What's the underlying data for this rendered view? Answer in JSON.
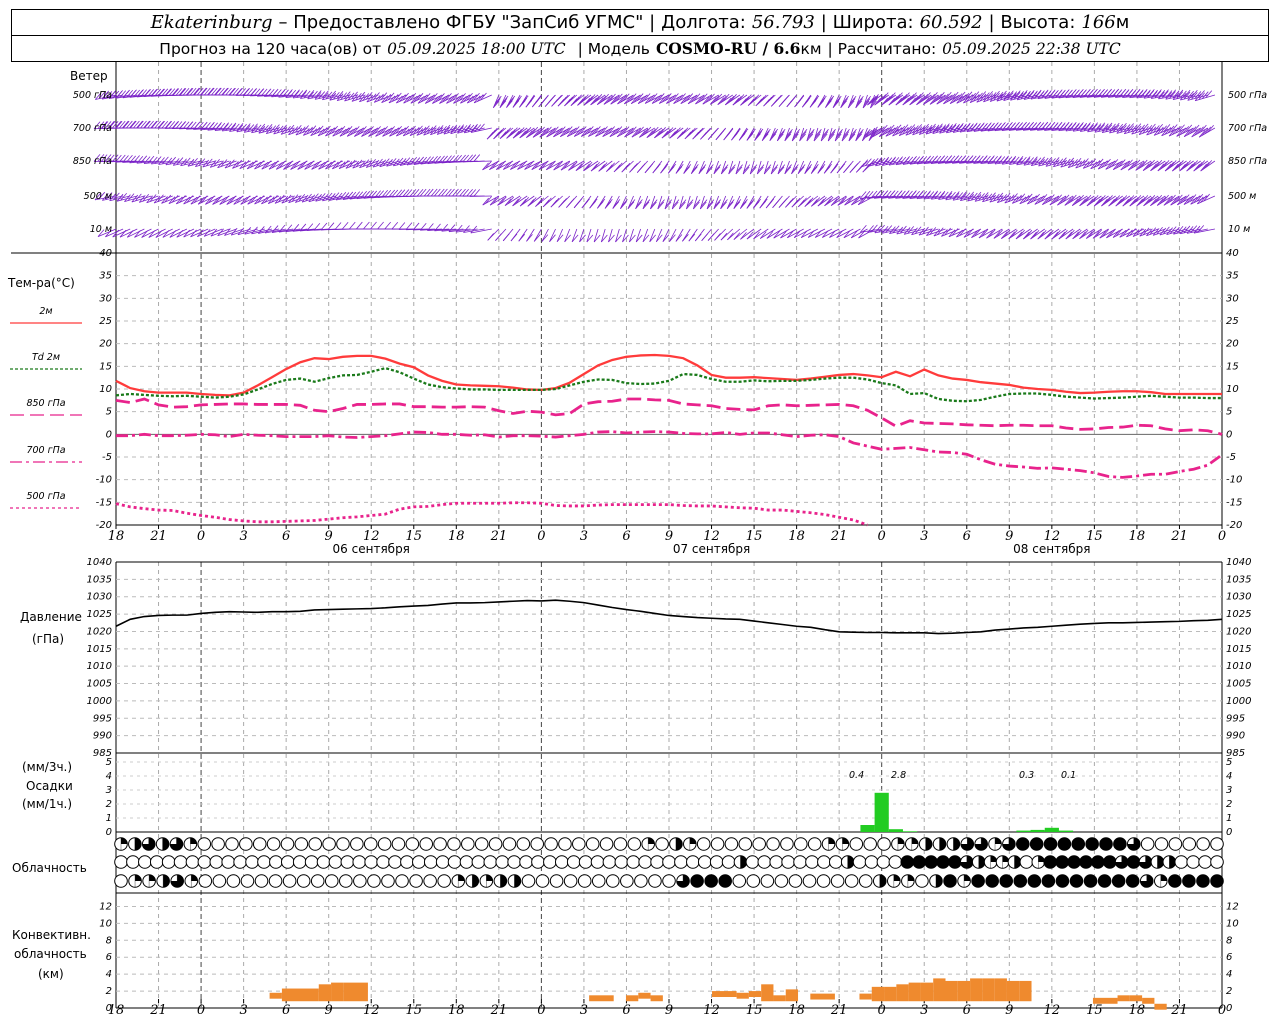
{
  "header": {
    "city": "Ekaterinburg",
    "provider": "– Предоставлено ФГБУ \"ЗапСиб УГМС\" |",
    "lon_label": "Долгота:",
    "lon": "56.793",
    "lat_label": "| Широта:",
    "lat": "60.592",
    "alt_label": "| Высота:",
    "alt": "166",
    "alt_unit": "м",
    "forecast_label": "Прогноз на 120 часа(ов) от",
    "init_time": "05.09.2025 18:00 UTC",
    "model_label": "| Модель",
    "model": "COSMO-RU / 6.6",
    "model_unit": "км",
    "calc_label": "| Рассчитано:",
    "calc_time": "05.09.2025 22:38 UTC"
  },
  "panels": {
    "wind": {
      "title": "Ветер",
      "levels": [
        "500 гПа",
        "700 гПа",
        "850 гПа",
        "500 м",
        "10 м"
      ]
    },
    "temp": {
      "title": "Тем-ра(°C)",
      "legend": [
        {
          "label": "2м",
          "color": "#ff3b3b",
          "dash": ""
        },
        {
          "label": "Td 2м",
          "color": "#1a7a1a",
          "dash": "3,2"
        },
        {
          "label": "850 гПа",
          "color": "#e8238c",
          "dash": "14,6"
        },
        {
          "label": "700 гПа",
          "color": "#e8238c",
          "dash": "12,4,3,4"
        },
        {
          "label": "500 гПа",
          "color": "#e8238c",
          "dash": "3,3"
        }
      ]
    },
    "pressure": {
      "title": "Давление",
      "unit": "(гПа)"
    },
    "precip": {
      "unit1": "(мм/3ч.)",
      "title": "Осадки",
      "unit2": "(мм/1ч.)",
      "annotations": [
        "0.4",
        "2.8",
        "0.3",
        "0.1"
      ]
    },
    "cloud": {
      "title": "Облачность"
    },
    "conv": {
      "title1": "Конвективн.",
      "title2": "облачность",
      "unit": "(км)"
    }
  },
  "time_axis": {
    "hour_labels": [
      "18",
      "21",
      "0",
      "3",
      "6",
      "9",
      "12",
      "15",
      "18",
      "21",
      "0",
      "3",
      "6",
      "9",
      "12",
      "15",
      "18",
      "21",
      "0",
      "3",
      "6",
      "9",
      "12",
      "15",
      "18",
      "21",
      "0"
    ],
    "days": [
      "06 сентября",
      "07 сентября",
      "08 сентября"
    ]
  },
  "chart_data": {
    "type": "line",
    "x_hours": [
      0,
      1,
      2,
      3,
      4,
      5,
      6,
      7,
      8,
      9,
      10,
      11,
      12,
      13,
      14,
      15,
      16,
      17,
      18,
      19,
      20,
      21,
      22,
      23,
      24,
      25,
      26,
      27,
      28,
      29,
      30,
      31,
      32,
      33,
      34,
      35,
      36,
      37,
      38,
      39,
      40,
      41,
      42,
      43,
      44,
      45,
      46,
      47,
      48,
      49,
      50,
      51,
      52,
      53,
      54,
      55,
      56,
      57,
      58,
      59,
      60,
      61,
      62,
      63,
      64,
      65,
      66,
      67,
      68,
      69,
      70,
      71,
      72,
      73,
      74,
      75,
      76,
      77,
      78
    ],
    "temperature": {
      "ylim": [
        -20,
        40
      ],
      "yticks": [
        -20,
        -15,
        -10,
        -5,
        0,
        5,
        10,
        15,
        20,
        25,
        30,
        35,
        40
      ],
      "series": [
        {
          "name": "2м",
          "values": [
            11.8,
            10.2,
            9.5,
            9.2,
            9.2,
            9.2,
            8.9,
            8.7,
            8.6,
            9.2,
            10.8,
            12.6,
            14.4,
            15.9,
            16.8,
            16.6,
            17.1,
            17.3,
            17.3,
            16.7,
            15.6,
            14.8,
            13.0,
            11.8,
            11.0,
            10.8,
            10.7,
            10.6,
            10.3,
            9.9,
            9.8,
            10.2,
            11.4,
            13.3,
            15.2,
            16.4,
            17.1,
            17.4,
            17.5,
            17.3,
            16.8,
            15.2,
            13.1,
            12.5,
            12.5,
            12.6,
            12.4,
            12.2,
            12.0,
            12.3,
            12.7,
            13.1,
            13.3,
            13.0,
            12.6,
            13.8,
            12.8,
            14.3,
            13.0,
            12.3,
            12.0,
            11.5,
            11.2,
            10.9,
            10.3,
            10.0,
            9.8,
            9.4,
            9.1,
            9.2,
            9.4,
            9.5,
            9.5,
            9.3,
            8.9,
            8.9,
            8.9,
            8.9,
            8.9
          ]
        },
        {
          "name": "Td 2м",
          "values": [
            8.6,
            8.9,
            8.7,
            8.5,
            8.4,
            8.5,
            8.3,
            8.1,
            8.3,
            8.8,
            9.9,
            11.1,
            12.0,
            12.3,
            11.6,
            12.4,
            13.0,
            13.1,
            13.8,
            14.6,
            13.7,
            12.3,
            11.0,
            10.4,
            10.1,
            9.9,
            9.9,
            9.8,
            9.8,
            9.8,
            9.8,
            10.0,
            10.8,
            11.6,
            12.1,
            12.0,
            11.3,
            11.1,
            11.2,
            11.8,
            13.3,
            13.1,
            12.2,
            11.6,
            11.6,
            11.9,
            11.7,
            11.8,
            11.8,
            12.0,
            12.3,
            12.5,
            12.5,
            12.1,
            11.3,
            10.8,
            8.9,
            9.1,
            7.8,
            7.4,
            7.3,
            7.6,
            8.3,
            8.9,
            9.0,
            9.0,
            8.7,
            8.3,
            8.1,
            7.9,
            8.0,
            8.1,
            8.3,
            8.5,
            8.3,
            8.1,
            8.1,
            8.0,
            8.0
          ]
        },
        {
          "name": "850 гПа",
          "values": [
            7.5,
            7.0,
            7.8,
            6.5,
            6.0,
            6.1,
            6.5,
            6.6,
            6.7,
            6.7,
            6.6,
            6.6,
            6.6,
            6.4,
            5.3,
            5.0,
            5.7,
            6.6,
            6.6,
            6.7,
            6.7,
            6.1,
            6.1,
            6.0,
            6.0,
            6.1,
            6.0,
            5.2,
            4.6,
            5.1,
            4.9,
            4.3,
            4.6,
            6.7,
            7.2,
            7.3,
            7.8,
            7.8,
            7.6,
            7.5,
            6.7,
            6.5,
            6.3,
            5.7,
            5.5,
            5.4,
            6.3,
            6.5,
            6.3,
            6.4,
            6.5,
            6.6,
            6.3,
            5.3,
            3.6,
            1.8,
            3.0,
            2.5,
            2.4,
            2.3,
            2.1,
            2.0,
            1.9,
            2.0,
            2.0,
            1.9,
            1.9,
            1.4,
            1.1,
            1.2,
            1.5,
            1.6,
            2.0,
            1.9,
            1.2,
            0.8,
            1.0,
            0.8,
            0.0
          ]
        },
        {
          "name": "700 гПа",
          "values": [
            -0.3,
            -0.3,
            0.0,
            -0.3,
            -0.3,
            -0.2,
            0.0,
            -0.1,
            -0.5,
            0.0,
            -0.2,
            -0.3,
            -0.5,
            -0.5,
            -0.5,
            -0.3,
            -0.6,
            -0.7,
            -0.5,
            -0.3,
            0.1,
            0.5,
            0.4,
            0.0,
            0.0,
            -0.2,
            -0.1,
            -0.6,
            -0.3,
            -0.3,
            -0.4,
            -0.6,
            -0.3,
            0.0,
            0.5,
            0.6,
            0.3,
            0.5,
            0.6,
            0.5,
            0.2,
            0.1,
            0.1,
            0.4,
            0.0,
            0.3,
            0.3,
            -0.1,
            -0.5,
            -0.2,
            -0.1,
            -0.5,
            -1.9,
            -2.6,
            -3.3,
            -3.1,
            -2.9,
            -3.4,
            -3.9,
            -4.0,
            -4.4,
            -5.6,
            -6.6,
            -7.0,
            -7.2,
            -7.5,
            -7.4,
            -7.7,
            -8.0,
            -8.5,
            -9.3,
            -9.5,
            -9.2,
            -8.8,
            -8.8,
            -8.2,
            -7.7,
            -6.8,
            -4.5
          ]
        },
        {
          "name": "500 гПа",
          "values": [
            -15.3,
            -16.0,
            -16.4,
            -16.7,
            -16.8,
            -17.4,
            -17.9,
            -18.3,
            -18.8,
            -19.1,
            -19.3,
            -19.3,
            -19.2,
            -19.1,
            -19.0,
            -18.7,
            -18.4,
            -18.2,
            -17.9,
            -17.6,
            -16.5,
            -16.0,
            -15.9,
            -15.5,
            -15.2,
            -15.2,
            -15.2,
            -15.2,
            -15.1,
            -15.1,
            -15.2,
            -15.7,
            -15.8,
            -15.8,
            -15.6,
            -15.5,
            -15.5,
            -15.5,
            -15.5,
            -15.5,
            -15.7,
            -15.8,
            -15.8,
            -16.0,
            -16.2,
            -16.3,
            -16.7,
            -16.7,
            -17.0,
            -17.3,
            -17.7,
            -18.3,
            -18.9,
            -20.0
          ]
        }
      ]
    },
    "pressure": {
      "ylim": [
        985,
        1040
      ],
      "yticks": [
        985,
        990,
        995,
        1000,
        1005,
        1010,
        1015,
        1020,
        1025,
        1030,
        1035,
        1040
      ],
      "values": [
        1021.5,
        1023.5,
        1024.3,
        1024.6,
        1024.7,
        1024.7,
        1025.2,
        1025.5,
        1025.7,
        1025.6,
        1025.5,
        1025.7,
        1025.7,
        1025.8,
        1026.2,
        1026.3,
        1026.4,
        1026.5,
        1026.6,
        1026.8,
        1027.1,
        1027.3,
        1027.5,
        1027.9,
        1028.2,
        1028.2,
        1028.3,
        1028.5,
        1028.7,
        1028.9,
        1028.8,
        1029.0,
        1028.7,
        1028.3,
        1027.6,
        1026.9,
        1026.3,
        1025.8,
        1025.2,
        1024.6,
        1024.3,
        1024.0,
        1023.8,
        1023.6,
        1023.5,
        1023.0,
        1022.5,
        1022.0,
        1021.5,
        1021.2,
        1020.5,
        1019.9,
        1019.8,
        1019.7,
        1019.7,
        1019.6,
        1019.6,
        1019.6,
        1019.4,
        1019.5,
        1019.7,
        1019.9,
        1020.4,
        1020.7,
        1021.0,
        1021.2,
        1021.5,
        1021.8,
        1022.1,
        1022.3,
        1022.5,
        1022.5,
        1022.6,
        1022.7,
        1022.8,
        1022.9,
        1023.1,
        1023.2,
        1023.5
      ]
    },
    "precipitation": {
      "ylim": [
        0,
        5
      ],
      "yticks": [
        0,
        1,
        2,
        3,
        4,
        5
      ],
      "bars": [
        {
          "hour": 53,
          "value": 0.5
        },
        {
          "hour": 54,
          "value": 2.8
        },
        {
          "hour": 55,
          "value": 0.2
        },
        {
          "hour": 56,
          "value": 0.05
        },
        {
          "hour": 64,
          "value": 0.1
        },
        {
          "hour": 65,
          "value": 0.15
        },
        {
          "hour": 66,
          "value": 0.3
        },
        {
          "hour": 67,
          "value": 0.1
        }
      ]
    },
    "cloud_cover": {
      "rows": [
        [
          2,
          4,
          6,
          4,
          6,
          2,
          0,
          0,
          0,
          0,
          0,
          0,
          0,
          0,
          0,
          0,
          0,
          0,
          0,
          0,
          0,
          0,
          0,
          0,
          0,
          0,
          0,
          0,
          0,
          0,
          0,
          0,
          0,
          0,
          0,
          0,
          0,
          0,
          2,
          0,
          4,
          2,
          0,
          0,
          0,
          0,
          0,
          0,
          0,
          0,
          0,
          2,
          2,
          0,
          0,
          0,
          2,
          2,
          4,
          4,
          4,
          6,
          6,
          2,
          6,
          8,
          8,
          8,
          8,
          8,
          8,
          8,
          8,
          6,
          0,
          0,
          0,
          0,
          0,
          0
        ],
        [
          0,
          0,
          0,
          0,
          0,
          0,
          0,
          0,
          0,
          0,
          0,
          0,
          0,
          0,
          0,
          0,
          0,
          0,
          0,
          0,
          0,
          0,
          0,
          0,
          0,
          0,
          0,
          0,
          0,
          0,
          0,
          0,
          0,
          0,
          0,
          0,
          0,
          0,
          0,
          0,
          0,
          0,
          0,
          0,
          0,
          0,
          0,
          0,
          0,
          0,
          0,
          0,
          4,
          0,
          0,
          0,
          0,
          0,
          0,
          0,
          0,
          4,
          0,
          0,
          0,
          0,
          8,
          8,
          8,
          8,
          8,
          6,
          4,
          2,
          2,
          4,
          0,
          2,
          8,
          8,
          8,
          8,
          8,
          8,
          6,
          8,
          6,
          4,
          4,
          0,
          0,
          0,
          0
        ],
        [
          0,
          2,
          2,
          4,
          6,
          2,
          0,
          0,
          0,
          0,
          0,
          0,
          0,
          0,
          0,
          0,
          0,
          0,
          0,
          0,
          0,
          0,
          0,
          0,
          2,
          4,
          2,
          4,
          4,
          0,
          0,
          0,
          0,
          0,
          0,
          0,
          0,
          0,
          0,
          0,
          6,
          8,
          8,
          8,
          0,
          0,
          0,
          0,
          0,
          0,
          0,
          0,
          0,
          0,
          4,
          2,
          2,
          0,
          4,
          8,
          2,
          8,
          8,
          8,
          8,
          8,
          8,
          8,
          8,
          8,
          8,
          8,
          8,
          6,
          2,
          8,
          8,
          8,
          8
        ]
      ]
    },
    "convective_cloud": {
      "ylim": [
        0,
        13
      ],
      "yticks": [
        0,
        2,
        4,
        6,
        8,
        10,
        12
      ],
      "segments": [
        {
          "from": 12.5,
          "to": 13.5,
          "top": 1.8
        },
        {
          "from": 13.5,
          "to": 16.5,
          "top": 2.3
        },
        {
          "from": 16.5,
          "to": 17.5,
          "top": 2.8
        },
        {
          "from": 17.5,
          "to": 18.5,
          "top": 3.0
        },
        {
          "from": 18.5,
          "to": 20.5,
          "top": 3.0
        },
        {
          "from": 38.5,
          "to": 40.5,
          "top": 1.5
        },
        {
          "from": 41.5,
          "to": 42.5,
          "top": 1.5
        },
        {
          "from": 42.5,
          "to": 43.5,
          "top": 1.8
        },
        {
          "from": 43.5,
          "to": 44.5,
          "top": 1.5
        },
        {
          "from": 48.5,
          "to": 50.5,
          "top": 2.0
        },
        {
          "from": 50.5,
          "to": 51.5,
          "top": 1.8
        },
        {
          "from": 51.5,
          "to": 52.5,
          "top": 2.0
        },
        {
          "from": 52.5,
          "to": 53.5,
          "top": 2.8
        },
        {
          "from": 53.5,
          "to": 54.5,
          "top": 1.5
        },
        {
          "from": 54.5,
          "to": 55.5,
          "top": 2.2
        },
        {
          "from": 56.5,
          "to": 58.5,
          "top": 1.7
        },
        {
          "from": 60.5,
          "to": 61.5,
          "top": 1.7
        },
        {
          "from": 61.5,
          "to": 62.5,
          "top": 2.5
        },
        {
          "from": 62.5,
          "to": 63.5,
          "top": 2.5
        },
        {
          "from": 63.5,
          "to": 64.5,
          "top": 2.8
        },
        {
          "from": 64.5,
          "to": 65.5,
          "top": 3.0
        },
        {
          "from": 65.5,
          "to": 66.5,
          "top": 3.0
        },
        {
          "from": 66.5,
          "to": 67.5,
          "top": 3.5
        },
        {
          "from": 67.5,
          "to": 68.5,
          "top": 3.2
        },
        {
          "from": 68.5,
          "to": 69.5,
          "top": 3.2
        },
        {
          "from": 69.5,
          "to": 70.5,
          "top": 3.5
        },
        {
          "from": 70.5,
          "to": 71.5,
          "top": 3.5
        },
        {
          "from": 71.5,
          "to": 72.5,
          "top": 3.5
        },
        {
          "from": 72.5,
          "to": 73.5,
          "top": 3.2
        },
        {
          "from": 73.5,
          "to": 74.5,
          "top": 3.2
        },
        {
          "from": 79.5,
          "to": 81.5,
          "top": 1.2
        },
        {
          "from": 81.5,
          "to": 82.5,
          "top": 1.5
        },
        {
          "from": 82.5,
          "to": 83.5,
          "top": 1.5
        },
        {
          "from": 83.5,
          "to": 84.5,
          "top": 1.2
        },
        {
          "from": 84.5,
          "to": 85.5,
          "top": 0.5
        }
      ]
    },
    "wind_levels": [
      "500 гПа",
      "700 гПа",
      "850 гПа",
      "500 м",
      "10 м"
    ]
  }
}
